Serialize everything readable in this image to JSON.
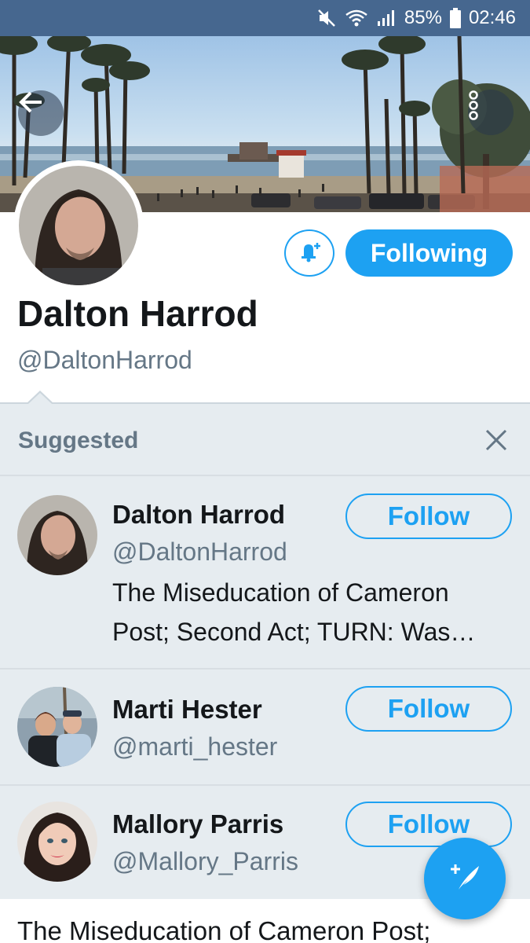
{
  "status_bar": {
    "battery": "85%",
    "time": "02:46"
  },
  "profile": {
    "name": "Dalton Harrod",
    "handle": "@DaltonHarrod",
    "following_label": "Following"
  },
  "suggested": {
    "title": "Suggested",
    "items": [
      {
        "name": "Dalton Harrod",
        "handle": "@DaltonHarrod",
        "bio_line1": "The Miseducation of Cameron",
        "bio_line2": "Post; Second Act; TURN: Was…",
        "follow_label": "Follow"
      },
      {
        "name": "Marti Hester",
        "handle": "@marti_hester",
        "follow_label": "Follow"
      },
      {
        "name": "Mallory Parris",
        "handle": "@Mallory_Parris",
        "follow_label": "Follow"
      }
    ]
  },
  "bottom_text": "The Miseducation of Cameron Post;",
  "colors": {
    "accent": "#1da1f2",
    "status_bar": "#46678f",
    "panel_bg": "#e6ecf0",
    "secondary_text": "#657786"
  },
  "icons": {
    "mute": "mute-icon",
    "wifi": "wifi-icon",
    "signal": "signal-icon",
    "battery": "battery-icon",
    "back": "back-arrow-icon",
    "more": "more-vertical-icon",
    "notify": "bell-plus-icon",
    "close": "close-icon",
    "compose": "compose-tweet-icon"
  }
}
